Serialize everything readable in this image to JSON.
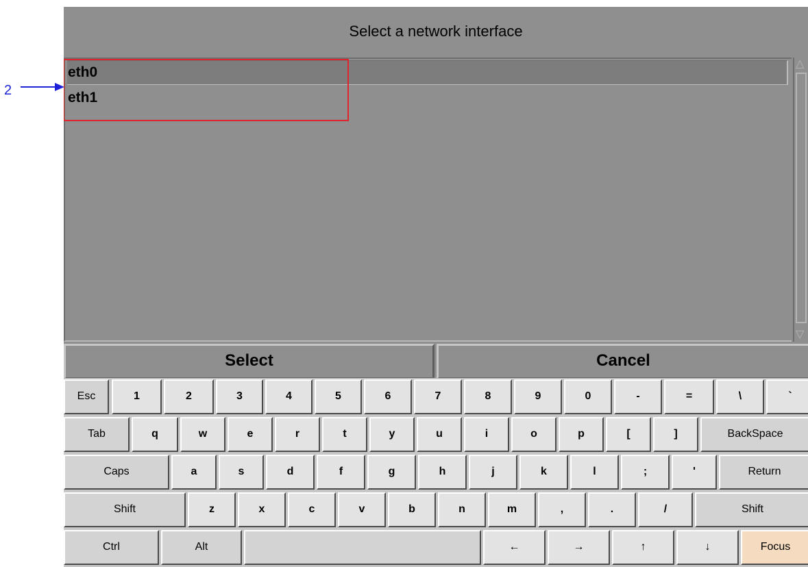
{
  "annotation": {
    "number": "2"
  },
  "dialog": {
    "title": "Select a network interface",
    "items": [
      {
        "label": "eth0",
        "selected": true
      },
      {
        "label": "eth1",
        "selected": false
      }
    ],
    "select_label": "Select",
    "cancel_label": "Cancel"
  },
  "keyboard": {
    "rows": [
      [
        "Esc",
        "1",
        "2",
        "3",
        "4",
        "5",
        "6",
        "7",
        "8",
        "9",
        "0",
        "-",
        "=",
        "\\",
        "`"
      ],
      [
        "Tab",
        "q",
        "w",
        "e",
        "r",
        "t",
        "y",
        "u",
        "i",
        "o",
        "p",
        "[",
        "]",
        "BackSpace"
      ],
      [
        "Caps",
        "a",
        "s",
        "d",
        "f",
        "g",
        "h",
        "j",
        "k",
        "l",
        ";",
        "'",
        "Return"
      ],
      [
        "Shift",
        "z",
        "x",
        "c",
        "v",
        "b",
        "n",
        "m",
        ",",
        ".",
        "/",
        "Shift"
      ],
      [
        "Ctrl",
        "Alt",
        "",
        "←",
        "→",
        "↑",
        "↓",
        "Focus"
      ]
    ]
  },
  "colors": {
    "annotation_blue": "#1d22d8",
    "highlight_red": "#e0242a",
    "window_gray": "#8f8f8f",
    "key_face": "#e3e3e3",
    "focus_key": "#f5dcc1"
  }
}
